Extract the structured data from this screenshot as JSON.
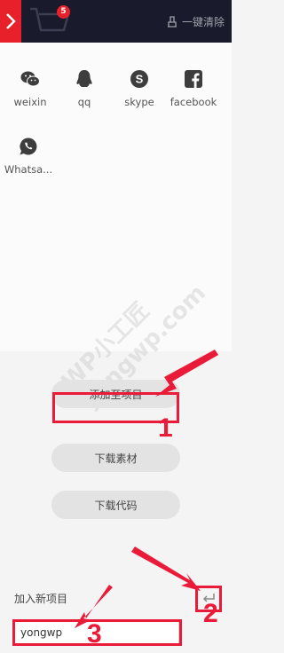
{
  "header": {
    "cart_count": "5",
    "clear_label": "一键清除"
  },
  "share": [
    {
      "label": "weixin",
      "icon": "wechat-icon"
    },
    {
      "label": "qq",
      "icon": "qq-icon"
    },
    {
      "label": "skype",
      "icon": "skype-icon"
    },
    {
      "label": "facebook",
      "icon": "facebook-icon"
    },
    {
      "label": "Whatsa...",
      "icon": "whatsapp-icon"
    }
  ],
  "actions": {
    "add_to_project": "添加至项目",
    "download_assets": "下载素材",
    "download_code": "下载代码"
  },
  "new_project": {
    "label": "加入新项目",
    "value": "yongwp"
  },
  "annotations": [
    "1",
    "2",
    "3"
  ],
  "watermark": [
    "WP小工匠",
    "yongwp.com"
  ],
  "colors": {
    "accent": "#e8202a",
    "topbar": "#191a2b",
    "annotation": "#ea1a39"
  }
}
